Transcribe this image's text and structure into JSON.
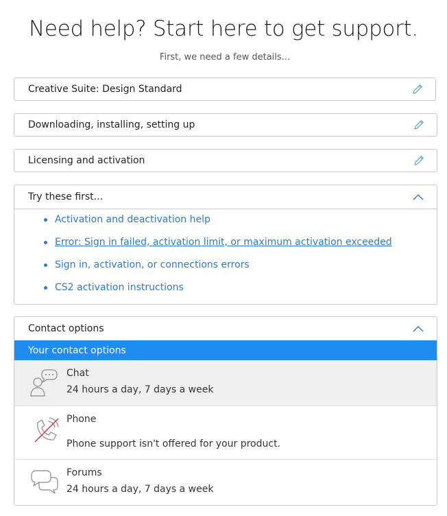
{
  "header": {
    "title": "Need help? Start here to get support.",
    "subtitle": "First, we need a few details..."
  },
  "steps": [
    {
      "label": "Creative Suite: Design Standard",
      "icon": "pencil-edit-icon"
    },
    {
      "label": "Downloading, installing, setting up",
      "icon": "pencil-edit-icon"
    },
    {
      "label": "Licensing and activation",
      "icon": "pencil-edit-icon"
    }
  ],
  "try_first": {
    "label": "Try these first...",
    "icon": "chevron-up-icon",
    "links": [
      {
        "text": "Activation and deactivation help"
      },
      {
        "text": "Error: Sign in failed, activation limit, or maximum activation exceeded"
      },
      {
        "text": "Sign in, activation, or connections errors"
      },
      {
        "text": "CS2 activation instructions"
      }
    ]
  },
  "contact": {
    "label": "Contact options",
    "icon": "chevron-up-icon",
    "bar_label": "Your contact options",
    "options": [
      {
        "name": "Chat",
        "desc": "24 hours a day, 7 days a week",
        "icon": "chat-agent-icon"
      },
      {
        "name": "Phone",
        "desc": "Phone support isn't offered for your product.",
        "icon": "phone-disabled-icon"
      },
      {
        "name": "Forums",
        "desc": "24 hours a day, 7 days a week",
        "icon": "forum-bubbles-icon"
      }
    ]
  },
  "colors": {
    "accent": "#1e8cf0",
    "link": "#2f79c6",
    "border": "#c9c9c9",
    "chat_bg": "#efefef"
  }
}
